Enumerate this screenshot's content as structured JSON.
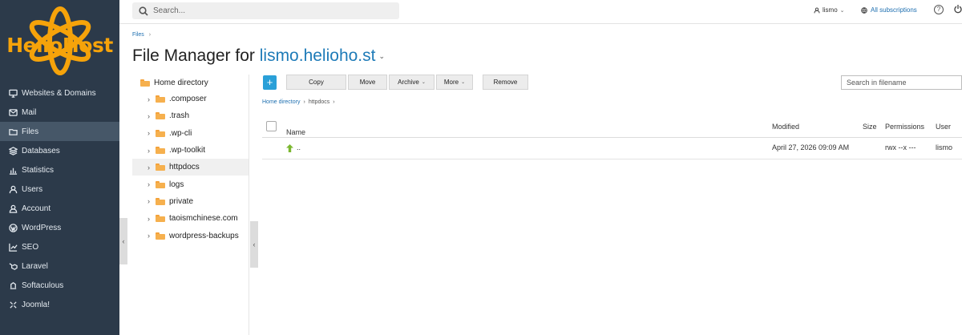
{
  "brand": {
    "name": "HelioHost",
    "accent": "#f6a30a"
  },
  "nav": [
    {
      "icon": "monitor-icon",
      "label": "Websites & Domains"
    },
    {
      "icon": "mail-icon",
      "label": "Mail"
    },
    {
      "icon": "folder-icon",
      "label": "Files",
      "active": true
    },
    {
      "icon": "database-icon",
      "label": "Databases"
    },
    {
      "icon": "bar-chart-icon",
      "label": "Statistics"
    },
    {
      "icon": "user-icon",
      "label": "Users"
    },
    {
      "icon": "account-icon",
      "label": "Account"
    },
    {
      "icon": "wordpress-icon",
      "label": "WordPress"
    },
    {
      "icon": "seo-icon",
      "label": "SEO"
    },
    {
      "icon": "laravel-icon",
      "label": "Laravel"
    },
    {
      "icon": "softaculous-icon",
      "label": "Softaculous"
    },
    {
      "icon": "joomla-icon",
      "label": "Joomla!"
    }
  ],
  "topbar": {
    "search_placeholder": "Search...",
    "user": "lismo",
    "user_caret": "⌄",
    "subscriptions": "All subscriptions",
    "help": "?"
  },
  "breadcrumb_top": {
    "label": "Files",
    "sep": "›"
  },
  "title": {
    "prefix": "File Manager for ",
    "domain": "lismo.helioho.st",
    "caret": "⌄"
  },
  "tree": {
    "root": "Home directory",
    "items": [
      {
        "label": ".composer"
      },
      {
        "label": ".trash"
      },
      {
        "label": ".wp-cli"
      },
      {
        "label": ".wp-toolkit"
      },
      {
        "label": "httpdocs",
        "selected": true
      },
      {
        "label": "logs"
      },
      {
        "label": "private"
      },
      {
        "label": "taoismchinese.com"
      },
      {
        "label": "wordpress-backups"
      }
    ],
    "chevron": "›"
  },
  "toolbar": {
    "add": "+",
    "copy": "Copy",
    "move": "Move",
    "archive": "Archive",
    "more": "More",
    "remove": "Remove",
    "caret": "⌄",
    "filter_placeholder": "Search in filename"
  },
  "path": {
    "home": "Home directory",
    "current": "httpdocs",
    "sep": "›"
  },
  "table": {
    "columns": {
      "name": "Name",
      "sort": "↑",
      "modified": "Modified",
      "size": "Size",
      "permissions": "Permissions",
      "user": "User"
    },
    "rows": [
      {
        "name": "..",
        "modified": "April 27, 2026 09:09 AM",
        "size": "",
        "permissions": "rwx --x ---",
        "user": "lismo"
      }
    ]
  },
  "collapse_glyph": "‹"
}
